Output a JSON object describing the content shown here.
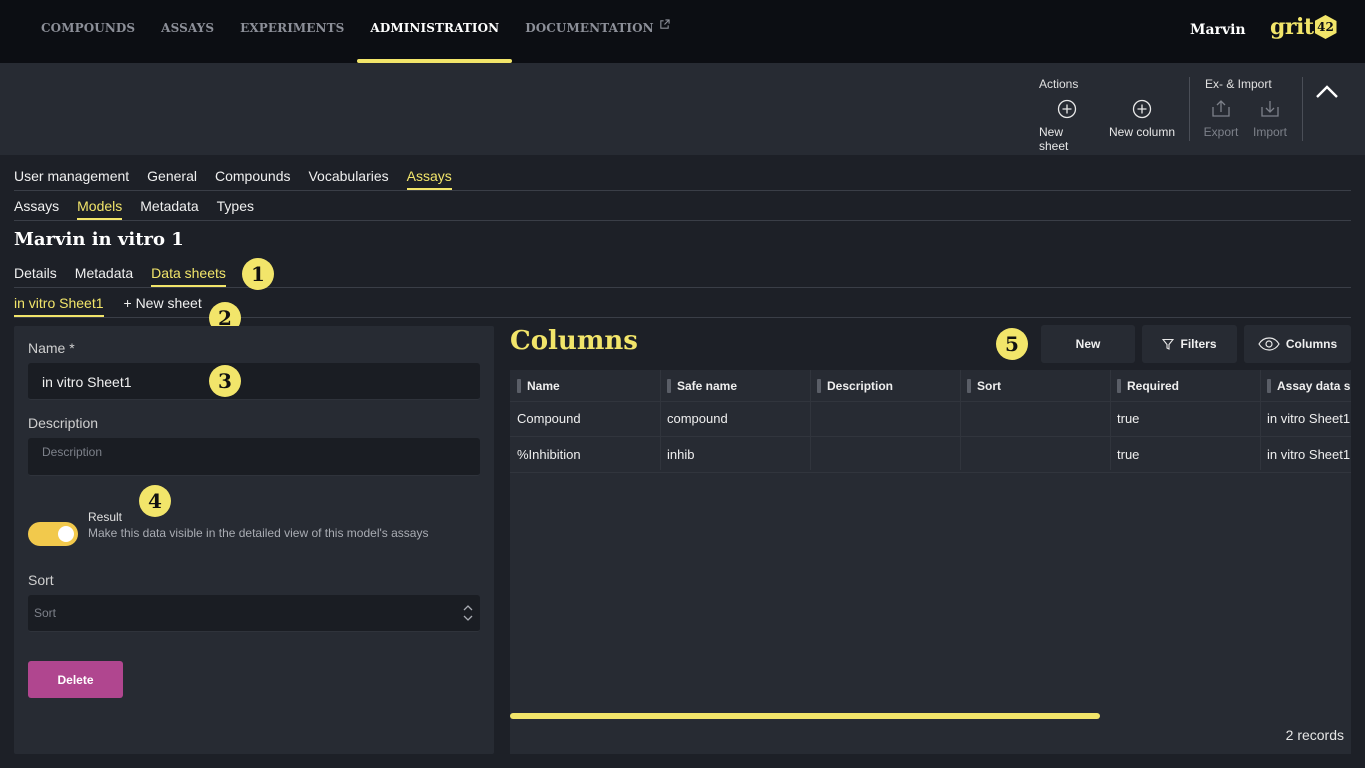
{
  "topnav": {
    "items": [
      {
        "label": "COMPOUNDS",
        "active": false
      },
      {
        "label": "ASSAYS",
        "active": false
      },
      {
        "label": "EXPERIMENTS",
        "active": false
      },
      {
        "label": "ADMINISTRATION",
        "active": true
      },
      {
        "label": "DOCUMENTATION",
        "active": false,
        "external": true
      }
    ],
    "user": "Marvin",
    "logo_text": "grit",
    "logo_badge": "42"
  },
  "toolbar": {
    "actions_title": "Actions",
    "new_sheet": "New sheet",
    "new_column": "New column",
    "eximport_title": "Ex- & Import",
    "export": "Export",
    "import": "Import"
  },
  "admin_tabs": [
    "User management",
    "General",
    "Compounds",
    "Vocabularies",
    "Assays"
  ],
  "admin_active": "Assays",
  "assay_tabs": [
    "Assays",
    "Models",
    "Metadata",
    "Types"
  ],
  "assay_active": "Models",
  "page_title": "Marvin in vitro 1",
  "model_tabs": [
    "Details",
    "Metadata",
    "Data sheets"
  ],
  "model_active": "Data sheets",
  "sheet_tabs": {
    "current": "in vitro Sheet1",
    "new": "+ New sheet"
  },
  "badges": [
    "1",
    "2",
    "3",
    "4",
    "5"
  ],
  "form": {
    "name_label": "Name *",
    "name_value": "in vitro Sheet1",
    "description_label": "Description",
    "description_placeholder": "Description",
    "result_title": "Result",
    "result_desc": "Make this data visible in the detailed view of this model's assays",
    "result_on": true,
    "sort_label": "Sort",
    "sort_placeholder": "Sort",
    "delete_label": "Delete"
  },
  "columns": {
    "title": "Columns",
    "new_label": "New",
    "filters_label": "Filters",
    "columns_label": "Columns",
    "headers": [
      "Name",
      "Safe name",
      "Description",
      "Sort",
      "Required",
      "Assay data s"
    ],
    "rows": [
      [
        "Compound",
        "compound",
        "",
        "",
        "true",
        "in vitro Sheet1"
      ],
      [
        "%Inhibition",
        "inhib",
        "",
        "",
        "true",
        "in vitro Sheet1"
      ]
    ],
    "records": "2 records"
  },
  "colors": {
    "accent": "#f2e56a",
    "danger": "#b0468f",
    "toggle": "#f2c94c"
  }
}
